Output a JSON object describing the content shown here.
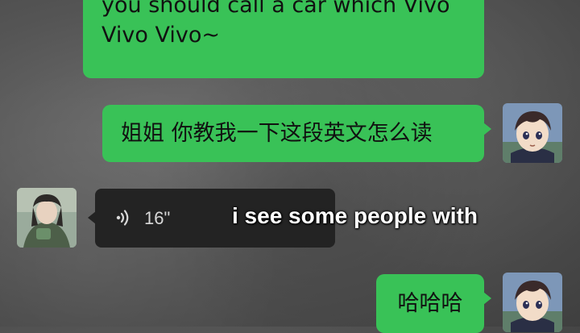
{
  "messages": {
    "english_partial": "...",
    "english_line2": "you should call a car which Vivo",
    "english_line3": "Vivo Vivo~",
    "chinese": "姐姐 你教我一下这段英文怎么读",
    "haha": "哈哈哈"
  },
  "voice_message": {
    "duration": "16\"",
    "icon": "voice-wave-icon"
  },
  "subtitle": "i see some people with",
  "colors": {
    "bubble_green": "#39c257",
    "voice_bg": "#232323",
    "background": "#555555"
  }
}
